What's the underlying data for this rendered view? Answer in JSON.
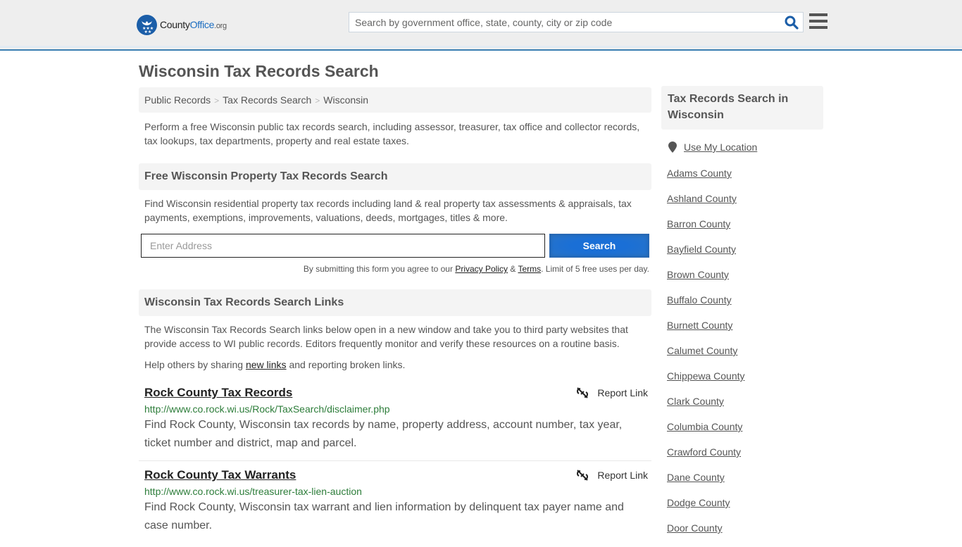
{
  "header": {
    "logo": {
      "name_part1": "County",
      "name_part2": "Office",
      "name_part3": ".org"
    },
    "search_placeholder": "Search by government office, state, county, city or zip code"
  },
  "page_title": "Wisconsin Tax Records Search",
  "breadcrumb": [
    "Public Records",
    "Tax Records Search",
    "Wisconsin"
  ],
  "intro": "Perform a free Wisconsin public tax records search, including assessor, treasurer, tax office and collector records, tax lookups, tax departments, property and real estate taxes.",
  "property_search": {
    "heading": "Free Wisconsin Property Tax Records Search",
    "description": "Find Wisconsin residential property tax records including land & real property tax assessments & appraisals, tax payments, exemptions, improvements, valuations, deeds, mortgages, titles & more.",
    "address_placeholder": "Enter Address",
    "button_label": "Search",
    "disclaimer_prefix": "By submitting this form you agree to our ",
    "privacy_label": "Privacy Policy",
    "amp": " & ",
    "terms_label": "Terms",
    "disclaimer_suffix": ". Limit of 5 free uses per day."
  },
  "links_section": {
    "heading": "Wisconsin Tax Records Search Links",
    "description": "The Wisconsin Tax Records Search links below open in a new window and take you to third party websites that provide access to WI public records. Editors frequently monitor and verify these resources on a routine basis.",
    "help_prefix": "Help others by sharing ",
    "help_link": "new links",
    "help_suffix": " and reporting broken links.",
    "report_label": "Report Link",
    "results": [
      {
        "title": "Rock County Tax Records",
        "url": "http://www.co.rock.wi.us/Rock/TaxSearch/disclaimer.php",
        "description": "Find Rock County, Wisconsin tax records by name, property address, account number, tax year, ticket number and district, map and parcel."
      },
      {
        "title": "Rock County Tax Warrants",
        "url": "http://www.co.rock.wi.us/treasurer-tax-lien-auction",
        "description": "Find Rock County, Wisconsin tax warrant and lien information by delinquent tax payer name and case number."
      }
    ]
  },
  "sidebar": {
    "heading": "Tax Records Search in Wisconsin",
    "use_location": "Use My Location",
    "counties": [
      "Adams County",
      "Ashland County",
      "Barron County",
      "Bayfield County",
      "Brown County",
      "Buffalo County",
      "Burnett County",
      "Calumet County",
      "Chippewa County",
      "Clark County",
      "Columbia County",
      "Crawford County",
      "Dane County",
      "Dodge County",
      "Door County"
    ]
  },
  "colors": {
    "header_bg": "#eeeeee",
    "header_border": "#3a7eb1",
    "brand_blue": "#1b5ea8",
    "button_blue": "#1a6fd6",
    "url_green": "#2d7d3a",
    "panel_bg": "#f4f4f4"
  }
}
